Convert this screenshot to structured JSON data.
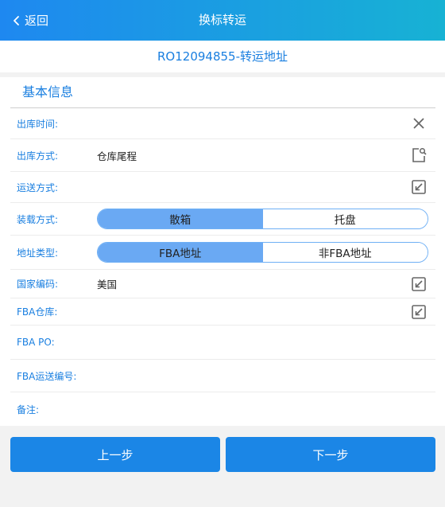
{
  "header": {
    "back_label": "返回",
    "title": "换标转运"
  },
  "subtitle": "RO12094855-转运地址",
  "section": {
    "title": "基本信息"
  },
  "fields": {
    "out_time": {
      "label": "出库时间:",
      "value": ""
    },
    "out_method": {
      "label": "出库方式:",
      "value": "仓库尾程"
    },
    "ship_method": {
      "label": "运送方式:",
      "value": ""
    },
    "load_method": {
      "label": "装载方式:",
      "options": [
        "散箱",
        "托盘"
      ],
      "selected": "散箱"
    },
    "address_type": {
      "label": "地址类型:",
      "options": [
        "FBA地址",
        "非FBA地址"
      ],
      "selected": "FBA地址"
    },
    "country_code": {
      "label": "国家编码:",
      "value": "美国"
    },
    "fba_warehouse": {
      "label": "FBA仓库:",
      "value": ""
    },
    "fba_po": {
      "label": "FBA PO:",
      "value": ""
    },
    "fba_ship_no": {
      "label": "FBA运送编号:",
      "value": ""
    },
    "remark": {
      "label": "备注:",
      "value": ""
    }
  },
  "buttons": {
    "prev": "上一步",
    "next": "下一步"
  },
  "icons": {
    "out_time": "close-icon",
    "out_method": "search-document-icon",
    "ship_method": "select-arrow-icon",
    "country_code": "select-arrow-icon",
    "fba_warehouse": "select-arrow-icon"
  },
  "colors": {
    "header_gradient_start": "#1e88f0",
    "header_gradient_end": "#17b2d4",
    "label": "#1a7fe0",
    "segment_active": "#6aa9f3",
    "button": "#1b86e6"
  }
}
